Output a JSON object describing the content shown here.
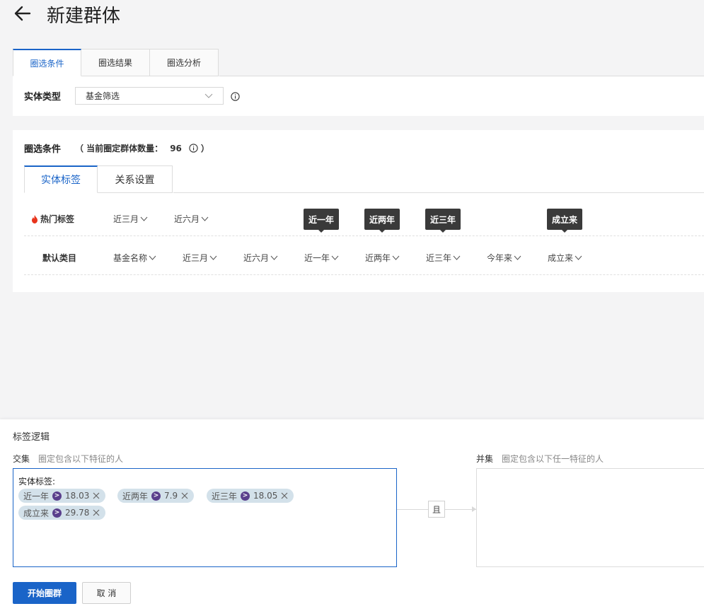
{
  "header": {
    "title": "新建群体"
  },
  "top_tabs": [
    {
      "label": "圈选条件",
      "active": true
    },
    {
      "label": "圈选结果",
      "active": false
    },
    {
      "label": "圈选分析",
      "active": false
    }
  ],
  "entity": {
    "label": "实体类型",
    "selected": "基金筛选"
  },
  "conditions": {
    "title": "圈选条件",
    "count_prefix": "（ 当前圈定群体数量：",
    "count": "96",
    "count_suffix": "）",
    "tabs": [
      {
        "label": "实体标签",
        "active": true
      },
      {
        "label": "关系设置",
        "active": false
      }
    ],
    "hot_row": {
      "label": "热门标签",
      "items": [
        "近三月",
        "近六月"
      ]
    },
    "default_row": {
      "label": "默认类目",
      "items": [
        "基金名称",
        "近三月",
        "近六月",
        "近一年",
        "近两年",
        "近三年",
        "今年来",
        "成立来"
      ]
    },
    "tooltips": [
      "近一年",
      "近两年",
      "近三年",
      "成立来"
    ]
  },
  "logic": {
    "title": "标签逻辑",
    "and_label": "交集",
    "and_hint": "圈定包含以下特征的人",
    "or_label": "并集",
    "or_hint": "圈定包含以下任一特征的人",
    "tag_heading": "实体标签:",
    "connector": "且",
    "chips": [
      {
        "name": "近一年",
        "op": ">",
        "value": "18.03"
      },
      {
        "name": "近两年",
        "op": ">",
        "value": "7.9"
      },
      {
        "name": "近三年",
        "op": ">",
        "value": "18.05"
      },
      {
        "name": "成立来",
        "op": ">",
        "value": "29.78"
      }
    ]
  },
  "actions": {
    "start": "开始圈群",
    "cancel": "取 消"
  },
  "colors": {
    "accent": "#1a64c8",
    "chip_bg": "#d3e1ea",
    "operator": "#5a3f8c",
    "tooltip": "#3a3a3a",
    "flame": "#e8341c"
  }
}
